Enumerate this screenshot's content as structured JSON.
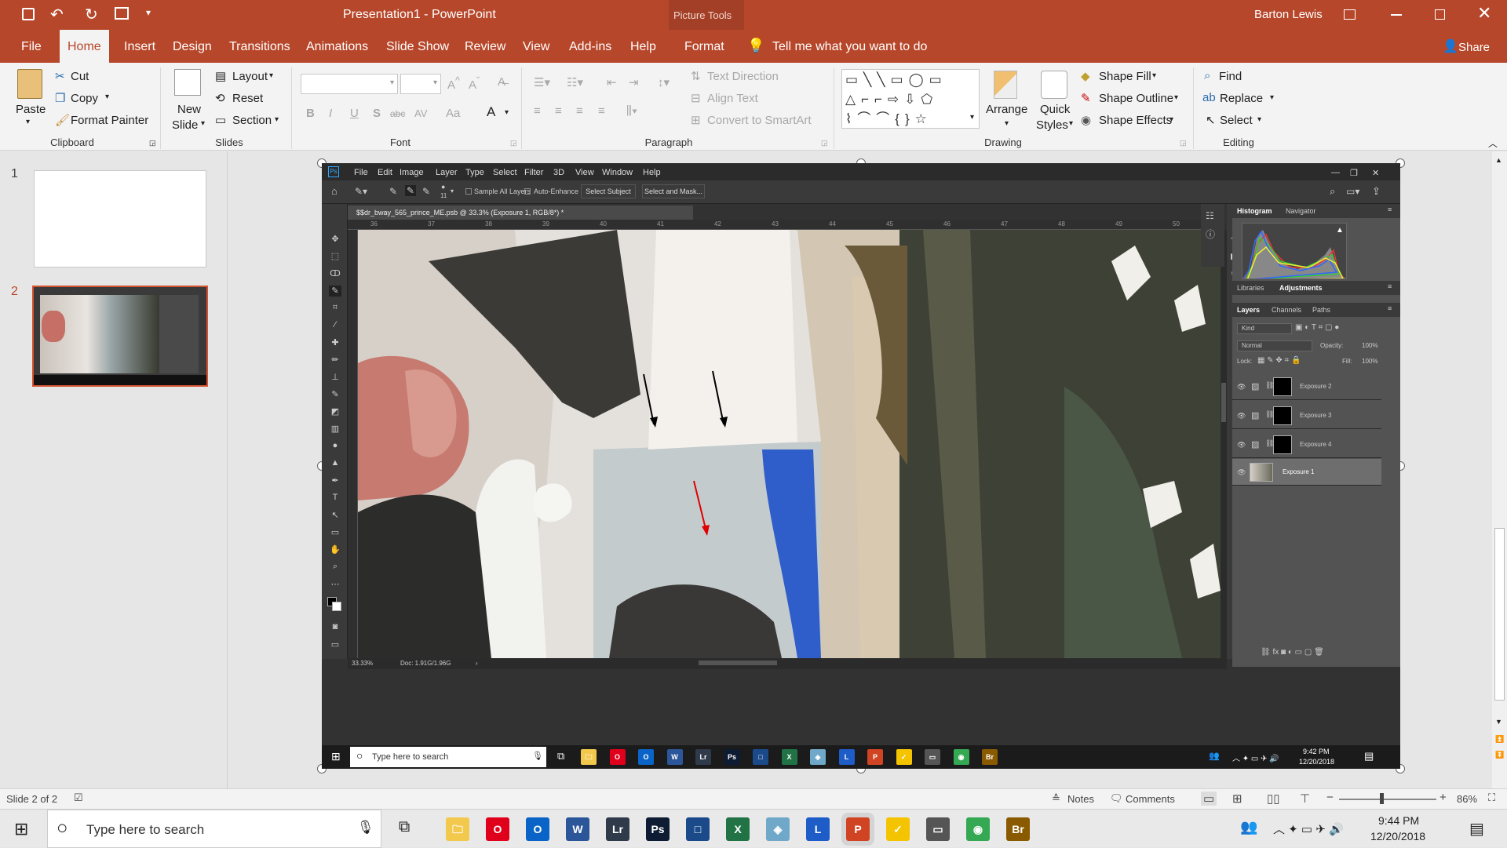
{
  "window": {
    "title": "Presentation1  -  PowerPoint",
    "picture_tools": "Picture Tools",
    "user": "Barton Lewis",
    "share": "Share"
  },
  "tabs": [
    "File",
    "Home",
    "Insert",
    "Design",
    "Transitions",
    "Animations",
    "Slide Show",
    "Review",
    "View",
    "Add-ins",
    "Help",
    "Format"
  ],
  "tell_me": "Tell me what you want to do",
  "ribbon": {
    "clipboard": {
      "paste": "Paste",
      "cut": "Cut",
      "copy": "Copy",
      "format_painter": "Format Painter",
      "label": "Clipboard"
    },
    "slides": {
      "new_slide": "New",
      "new_slide2": "Slide",
      "layout": "Layout",
      "reset": "Reset",
      "section": "Section",
      "label": "Slides"
    },
    "font": {
      "label": "Font",
      "bold": "B",
      "italic": "I",
      "underline": "U",
      "shadow": "S",
      "strike": "abc",
      "spacing": "AV",
      "case": "Aa",
      "color": "A"
    },
    "paragraph": {
      "text_direction": "Text Direction",
      "align_text": "Align Text",
      "smartart": "Convert to SmartArt",
      "label": "Paragraph"
    },
    "drawing": {
      "arrange": "Arrange",
      "quick_styles": "Quick",
      "quick_styles2": "Styles",
      "shape_fill": "Shape Fill",
      "shape_outline": "Shape Outline",
      "shape_effects": "Shape Effects",
      "label": "Drawing"
    },
    "editing": {
      "find": "Find",
      "replace": "Replace",
      "select": "Select",
      "label": "Editing"
    }
  },
  "thumbnails": [
    {
      "num": "1"
    },
    {
      "num": "2"
    }
  ],
  "photoshop": {
    "menu": [
      "File",
      "Edit",
      "Image",
      "Layer",
      "Type",
      "Select",
      "Filter",
      "3D",
      "View",
      "Window",
      "Help"
    ],
    "options": {
      "brush_size": "11",
      "sample_all": "Sample All Layers",
      "auto_enhance": "Auto-Enhance",
      "select_subject": "Select Subject",
      "select_mask": "Select and Mask..."
    },
    "doc_tab": "$$dr_bway_565_prince_ME.psb @ 33.3% (Exposure 1, RGB/8*) *",
    "ruler": [
      "36",
      "37",
      "38",
      "39",
      "40",
      "41",
      "42",
      "43",
      "44",
      "45",
      "46",
      "47",
      "48",
      "49",
      "50"
    ],
    "status_zoom": "33.33%",
    "status_doc": "Doc: 1.91G/1.96G",
    "panels": {
      "histogram": "Histogram",
      "navigator": "Navigator",
      "libraries": "Libraries",
      "adjustments": "Adjustments",
      "layers": "Layers",
      "channels": "Channels",
      "paths": "Paths",
      "kind": "Kind",
      "blend": "Normal",
      "opacity_label": "Opacity:",
      "opacity": "100%",
      "lock": "Lock:",
      "fill_label": "Fill:",
      "fill": "100%"
    },
    "layers": [
      {
        "name": "Exposure 2"
      },
      {
        "name": "Exposure 3"
      },
      {
        "name": "Exposure 4"
      },
      {
        "name": "Exposure 1"
      }
    ],
    "taskbar_search": "Type here to search",
    "clock_time": "9:42 PM",
    "clock_date": "12/20/2018"
  },
  "status": {
    "slide": "Slide 2 of 2",
    "notes": "Notes",
    "comments": "Comments",
    "zoom": "86%"
  },
  "taskbar": {
    "search": "Type here to search",
    "time": "9:44 PM",
    "date": "12/20/2018"
  },
  "colors": {
    "accent": "#b7472a",
    "ps_bg": "#323232",
    "ps_panel": "#535353"
  }
}
